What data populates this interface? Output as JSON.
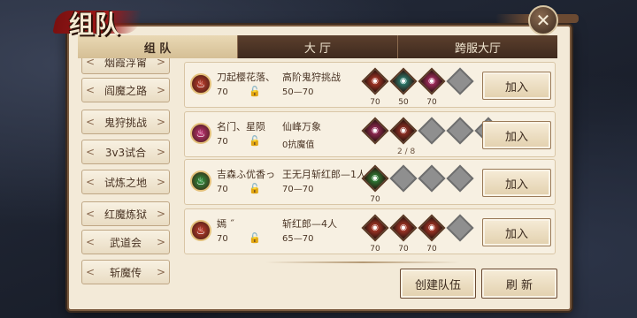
{
  "title": "组队",
  "close_icon": "✕",
  "tabs": [
    "组 队",
    "大 厅",
    "跨服大厅"
  ],
  "categories": [
    "烟霞浮甯",
    "阎魔之路",
    "鬼狩挑战",
    "3v3试合",
    "试炼之地",
    "红魔炼狱",
    "武道会",
    "斩魔传"
  ],
  "teams": [
    {
      "leader": "刀起樱花落、",
      "level": "70",
      "activity": "高阶鬼狩挑战",
      "requirement": "50—70",
      "leader_color": "#c8402e",
      "members": [
        {
          "level": "70",
          "color": "#c8402e"
        },
        {
          "level": "50",
          "color": "#2a9a8a"
        },
        {
          "level": "70",
          "color": "#c8347a"
        }
      ],
      "empty_slots": 1,
      "join_label": "加入"
    },
    {
      "leader": "名门、星陨",
      "level": "70",
      "activity": "仙峰万象",
      "requirement": "0抗魔值",
      "leader_color": "#c8347a",
      "members": [
        {
          "level": "",
          "color": "#b0306a"
        },
        {
          "level": "",
          "color": "#b03a2e"
        }
      ],
      "empty_slots": 3,
      "pager": "2 / 8",
      "join_label": "加入"
    },
    {
      "leader": "吉森ふ优香っ",
      "level": "70",
      "activity": "王无月斩红郎—1人",
      "requirement": "70—70",
      "leader_color": "#2e9a40",
      "members": [
        {
          "level": "70",
          "color": "#2e9a40"
        }
      ],
      "empty_slots": 3,
      "join_label": "加入"
    },
    {
      "leader": "嫣 ˝",
      "level": "70",
      "activity": "斩红郎—4人",
      "requirement": "65—70",
      "leader_color": "#c8402e",
      "members": [
        {
          "level": "70",
          "color": "#c8402e"
        },
        {
          "level": "70",
          "color": "#c8402e"
        },
        {
          "level": "70",
          "color": "#c8402e"
        }
      ],
      "empty_slots": 1,
      "join_label": "加入"
    }
  ],
  "create_team_label": "创建队伍",
  "refresh_label": "刷  新"
}
